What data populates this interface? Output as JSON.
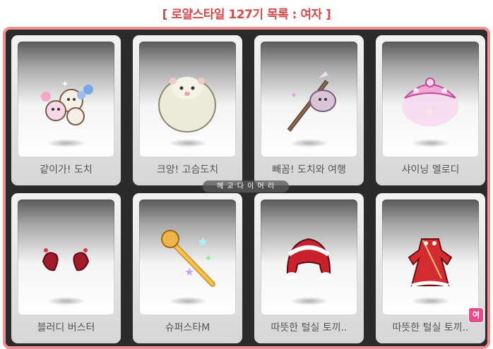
{
  "title": "[ 로얄스타일 127기 목록 : 여자 ]",
  "watermark": "헤 교 다 이 어 리",
  "items": [
    {
      "name": "같이가! 도치",
      "icon": "hedgehog-friends-icon"
    },
    {
      "name": "크앙! 고슴도치",
      "icon": "white-hedgehog-icon"
    },
    {
      "name": "빼꼼! 도치와 여행",
      "icon": "hedgehog-bindle-icon"
    },
    {
      "name": "샤이닝 멜로디",
      "icon": "shining-melody-crown-icon"
    },
    {
      "name": "블러디 버스터",
      "icon": "bloody-buster-icon"
    },
    {
      "name": "슈퍼스타M",
      "icon": "superstar-microphone-icon"
    },
    {
      "name": "따뜻한 털실 토끼..",
      "icon": "wool-rabbit-hat-icon"
    },
    {
      "name": "따뜻한 털실 토끼..",
      "icon": "wool-rabbit-dress-icon",
      "badge": "여"
    }
  ],
  "colors": {
    "title": "#d44a4a",
    "frame_border": "#f08f8f",
    "frame_bg": "#2b2b2b",
    "badge": "#e64b8c"
  }
}
